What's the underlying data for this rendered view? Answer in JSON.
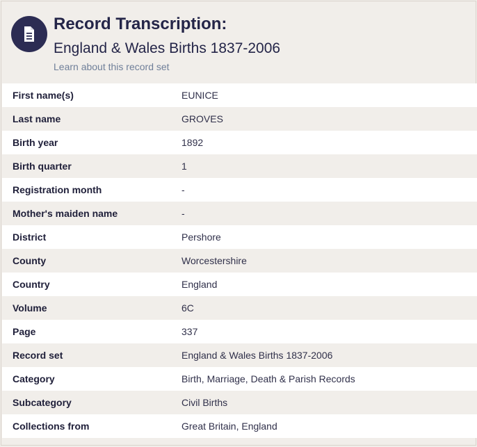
{
  "header": {
    "title": "Record Transcription:",
    "subtitle": "England & Wales Births 1837-2006",
    "learn_link": "Learn about this record set"
  },
  "icons": {
    "header_icon": "document-icon"
  },
  "colors": {
    "badge_bg": "#2c2c53",
    "page_bg": "#f1eeea",
    "row_white": "#ffffff",
    "link": "#6f7f99"
  },
  "records": [
    {
      "label": "First name(s)",
      "value": "EUNICE"
    },
    {
      "label": "Last name",
      "value": "GROVES"
    },
    {
      "label": "Birth year",
      "value": "1892"
    },
    {
      "label": "Birth quarter",
      "value": "1"
    },
    {
      "label": "Registration month",
      "value": "-"
    },
    {
      "label": "Mother's maiden name",
      "value": "-"
    },
    {
      "label": "District",
      "value": "Pershore"
    },
    {
      "label": "County",
      "value": "Worcestershire"
    },
    {
      "label": "Country",
      "value": "England"
    },
    {
      "label": "Volume",
      "value": "6C"
    },
    {
      "label": "Page",
      "value": "337"
    },
    {
      "label": "Record set",
      "value": "England & Wales Births 1837-2006"
    },
    {
      "label": "Category",
      "value": "Birth, Marriage, Death & Parish Records"
    },
    {
      "label": "Subcategory",
      "value": "Civil Births"
    },
    {
      "label": "Collections from",
      "value": "Great Britain, England"
    }
  ]
}
